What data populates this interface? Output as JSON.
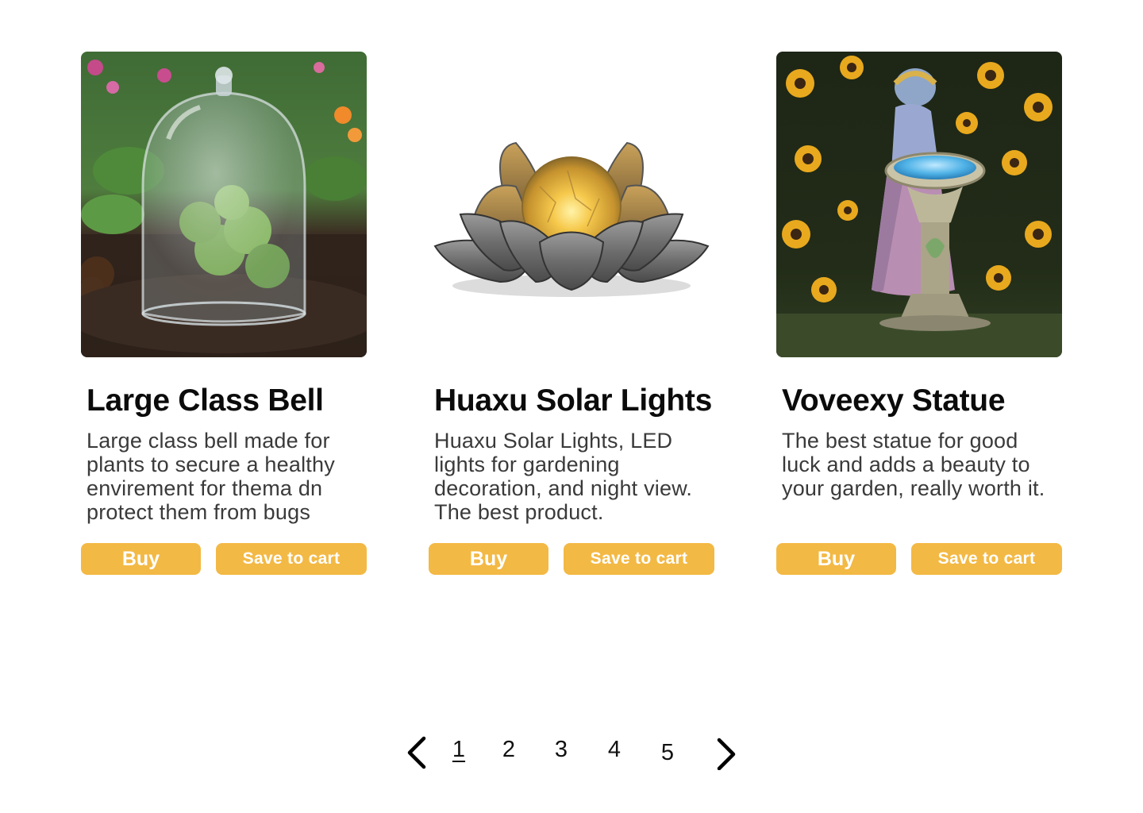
{
  "products": [
    {
      "title": "Large Class Bell",
      "description": "Large class bell made for plants to secure a healthy envirement for thema dn protect them from bugs",
      "buy_label": "Buy",
      "cart_label": "Save to cart",
      "image": "glass-cloche-over-parsley-in-garden"
    },
    {
      "title": "Huaxu Solar Lights",
      "description": "Huaxu Solar Lights, LED lights for gardening decoration, and night view. The best product.",
      "buy_label": "Buy",
      "cart_label": "Save to cart",
      "image": "lotus-solar-light-with-glowing-orb"
    },
    {
      "title": "Voveexy Statue",
      "description": "The best statue for good luck and adds a beauty to your garden, really worth it.",
      "buy_label": "Buy",
      "cart_label": "Save to cart",
      "image": "girl-statue-with-birdbath-among-sunflowers"
    }
  ],
  "pagination": {
    "pages": [
      "1",
      "2",
      "3",
      "4",
      "5"
    ],
    "current": "1",
    "prev_icon": "chevron-left-icon",
    "next_icon": "chevron-right-icon"
  },
  "colors": {
    "button": "#f3b945",
    "button_text": "#ffffff",
    "title": "#0b0b0b",
    "description": "#3a3a3a"
  }
}
